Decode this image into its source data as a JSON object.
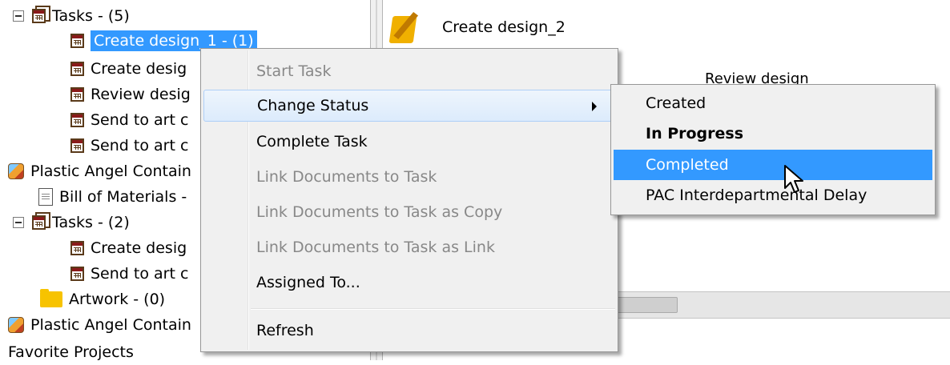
{
  "tree": {
    "items": [
      {
        "label": "Tasks - (5)"
      },
      {
        "label": "Create design_1 - (1)"
      },
      {
        "label": "Create desig"
      },
      {
        "label": "Review desig"
      },
      {
        "label": "Send to art c"
      },
      {
        "label": "Send to art c"
      },
      {
        "label": "Plastic Angel Contain"
      },
      {
        "label": "Bill of Materials -"
      },
      {
        "label": "Tasks - (2)"
      },
      {
        "label": "Create desig"
      },
      {
        "label": "Send to art c"
      },
      {
        "label": "Artwork - (0)"
      },
      {
        "label": "Plastic Angel Contain"
      },
      {
        "label": "Favorite Projects"
      }
    ]
  },
  "right_pane": {
    "item_title": "Create design_2",
    "partial_text": "Review design"
  },
  "context_menu": {
    "items": [
      {
        "label": "Start Task"
      },
      {
        "label": "Change Status"
      },
      {
        "label": "Complete Task"
      },
      {
        "label": "Link Documents to Task"
      },
      {
        "label": "Link Documents to Task as Copy"
      },
      {
        "label": "Link Documents to Task as Link"
      },
      {
        "label": "Assigned To..."
      },
      {
        "label": "Refresh"
      }
    ]
  },
  "status_submenu": {
    "items": [
      {
        "label": "Created"
      },
      {
        "label": "In Progress"
      },
      {
        "label": "Completed"
      },
      {
        "label": "PAC Interdepartmental Delay"
      }
    ]
  },
  "colors": {
    "selection": "#3399ff",
    "menu_background": "#f0f0f0",
    "hover_border": "#aecff7"
  }
}
